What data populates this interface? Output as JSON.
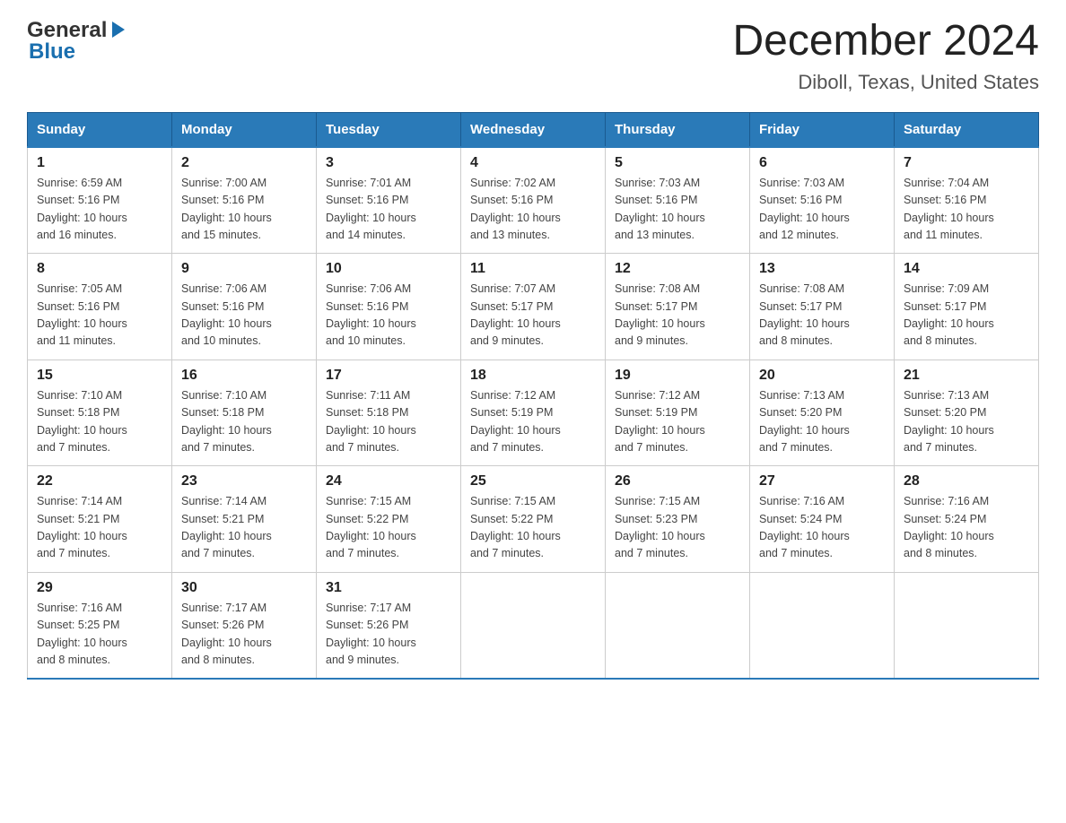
{
  "logo": {
    "text_general": "General",
    "text_blue": "Blue",
    "arrow_char": "▶"
  },
  "title": "December 2024",
  "subtitle": "Diboll, Texas, United States",
  "days_of_week": [
    "Sunday",
    "Monday",
    "Tuesday",
    "Wednesday",
    "Thursday",
    "Friday",
    "Saturday"
  ],
  "weeks": [
    [
      {
        "day": "1",
        "sunrise": "6:59 AM",
        "sunset": "5:16 PM",
        "daylight": "10 hours and 16 minutes."
      },
      {
        "day": "2",
        "sunrise": "7:00 AM",
        "sunset": "5:16 PM",
        "daylight": "10 hours and 15 minutes."
      },
      {
        "day": "3",
        "sunrise": "7:01 AM",
        "sunset": "5:16 PM",
        "daylight": "10 hours and 14 minutes."
      },
      {
        "day": "4",
        "sunrise": "7:02 AM",
        "sunset": "5:16 PM",
        "daylight": "10 hours and 13 minutes."
      },
      {
        "day": "5",
        "sunrise": "7:03 AM",
        "sunset": "5:16 PM",
        "daylight": "10 hours and 13 minutes."
      },
      {
        "day": "6",
        "sunrise": "7:03 AM",
        "sunset": "5:16 PM",
        "daylight": "10 hours and 12 minutes."
      },
      {
        "day": "7",
        "sunrise": "7:04 AM",
        "sunset": "5:16 PM",
        "daylight": "10 hours and 11 minutes."
      }
    ],
    [
      {
        "day": "8",
        "sunrise": "7:05 AM",
        "sunset": "5:16 PM",
        "daylight": "10 hours and 11 minutes."
      },
      {
        "day": "9",
        "sunrise": "7:06 AM",
        "sunset": "5:16 PM",
        "daylight": "10 hours and 10 minutes."
      },
      {
        "day": "10",
        "sunrise": "7:06 AM",
        "sunset": "5:16 PM",
        "daylight": "10 hours and 10 minutes."
      },
      {
        "day": "11",
        "sunrise": "7:07 AM",
        "sunset": "5:17 PM",
        "daylight": "10 hours and 9 minutes."
      },
      {
        "day": "12",
        "sunrise": "7:08 AM",
        "sunset": "5:17 PM",
        "daylight": "10 hours and 9 minutes."
      },
      {
        "day": "13",
        "sunrise": "7:08 AM",
        "sunset": "5:17 PM",
        "daylight": "10 hours and 8 minutes."
      },
      {
        "day": "14",
        "sunrise": "7:09 AM",
        "sunset": "5:17 PM",
        "daylight": "10 hours and 8 minutes."
      }
    ],
    [
      {
        "day": "15",
        "sunrise": "7:10 AM",
        "sunset": "5:18 PM",
        "daylight": "10 hours and 7 minutes."
      },
      {
        "day": "16",
        "sunrise": "7:10 AM",
        "sunset": "5:18 PM",
        "daylight": "10 hours and 7 minutes."
      },
      {
        "day": "17",
        "sunrise": "7:11 AM",
        "sunset": "5:18 PM",
        "daylight": "10 hours and 7 minutes."
      },
      {
        "day": "18",
        "sunrise": "7:12 AM",
        "sunset": "5:19 PM",
        "daylight": "10 hours and 7 minutes."
      },
      {
        "day": "19",
        "sunrise": "7:12 AM",
        "sunset": "5:19 PM",
        "daylight": "10 hours and 7 minutes."
      },
      {
        "day": "20",
        "sunrise": "7:13 AM",
        "sunset": "5:20 PM",
        "daylight": "10 hours and 7 minutes."
      },
      {
        "day": "21",
        "sunrise": "7:13 AM",
        "sunset": "5:20 PM",
        "daylight": "10 hours and 7 minutes."
      }
    ],
    [
      {
        "day": "22",
        "sunrise": "7:14 AM",
        "sunset": "5:21 PM",
        "daylight": "10 hours and 7 minutes."
      },
      {
        "day": "23",
        "sunrise": "7:14 AM",
        "sunset": "5:21 PM",
        "daylight": "10 hours and 7 minutes."
      },
      {
        "day": "24",
        "sunrise": "7:15 AM",
        "sunset": "5:22 PM",
        "daylight": "10 hours and 7 minutes."
      },
      {
        "day": "25",
        "sunrise": "7:15 AM",
        "sunset": "5:22 PM",
        "daylight": "10 hours and 7 minutes."
      },
      {
        "day": "26",
        "sunrise": "7:15 AM",
        "sunset": "5:23 PM",
        "daylight": "10 hours and 7 minutes."
      },
      {
        "day": "27",
        "sunrise": "7:16 AM",
        "sunset": "5:24 PM",
        "daylight": "10 hours and 7 minutes."
      },
      {
        "day": "28",
        "sunrise": "7:16 AM",
        "sunset": "5:24 PM",
        "daylight": "10 hours and 8 minutes."
      }
    ],
    [
      {
        "day": "29",
        "sunrise": "7:16 AM",
        "sunset": "5:25 PM",
        "daylight": "10 hours and 8 minutes."
      },
      {
        "day": "30",
        "sunrise": "7:17 AM",
        "sunset": "5:26 PM",
        "daylight": "10 hours and 8 minutes."
      },
      {
        "day": "31",
        "sunrise": "7:17 AM",
        "sunset": "5:26 PM",
        "daylight": "10 hours and 9 minutes."
      },
      null,
      null,
      null,
      null
    ]
  ]
}
